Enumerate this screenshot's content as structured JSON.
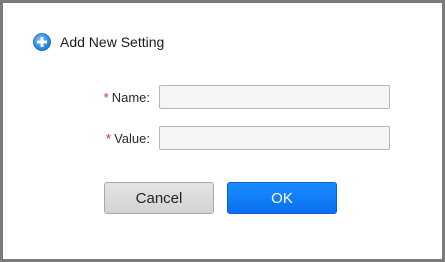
{
  "dialog": {
    "title": "Add New Setting",
    "header_icon": "plus-circle-icon",
    "accent_color": "#1a8cff"
  },
  "form": {
    "required_marker": "*",
    "name_label": "Name:",
    "name_value": "",
    "value_label": "Value:",
    "value_value": ""
  },
  "buttons": {
    "cancel_label": "Cancel",
    "ok_label": "OK"
  }
}
